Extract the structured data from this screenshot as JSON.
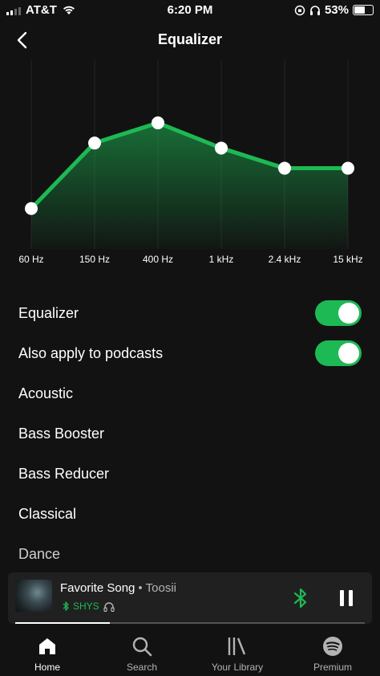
{
  "status": {
    "carrier": "AT&T",
    "time": "6:20 PM",
    "battery": "53%"
  },
  "header": {
    "title": "Equalizer"
  },
  "chart_data": {
    "type": "area",
    "categories": [
      "60 Hz",
      "150 Hz",
      "400 Hz",
      "1 kHz",
      "2.4 kHz",
      "15 kHz"
    ],
    "values": [
      -2,
      4.5,
      6.5,
      4,
      2,
      2
    ],
    "ylim": [
      -6,
      12
    ],
    "color": "#1db954"
  },
  "settings": {
    "equalizer_label": "Equalizer",
    "podcasts_label": "Also apply to podcasts",
    "presets": [
      "Acoustic",
      "Bass Booster",
      "Bass Reducer",
      "Classical",
      "Dance"
    ]
  },
  "player": {
    "song": "Favorite Song",
    "separator": "•",
    "artist": "Toosii",
    "device": "SHYS",
    "progress": 0.27
  },
  "nav": {
    "home": "Home",
    "search": "Search",
    "library": "Your Library",
    "premium": "Premium"
  },
  "colors": {
    "accent": "#1db954",
    "background": "#121212",
    "player_bg": "#202020"
  }
}
